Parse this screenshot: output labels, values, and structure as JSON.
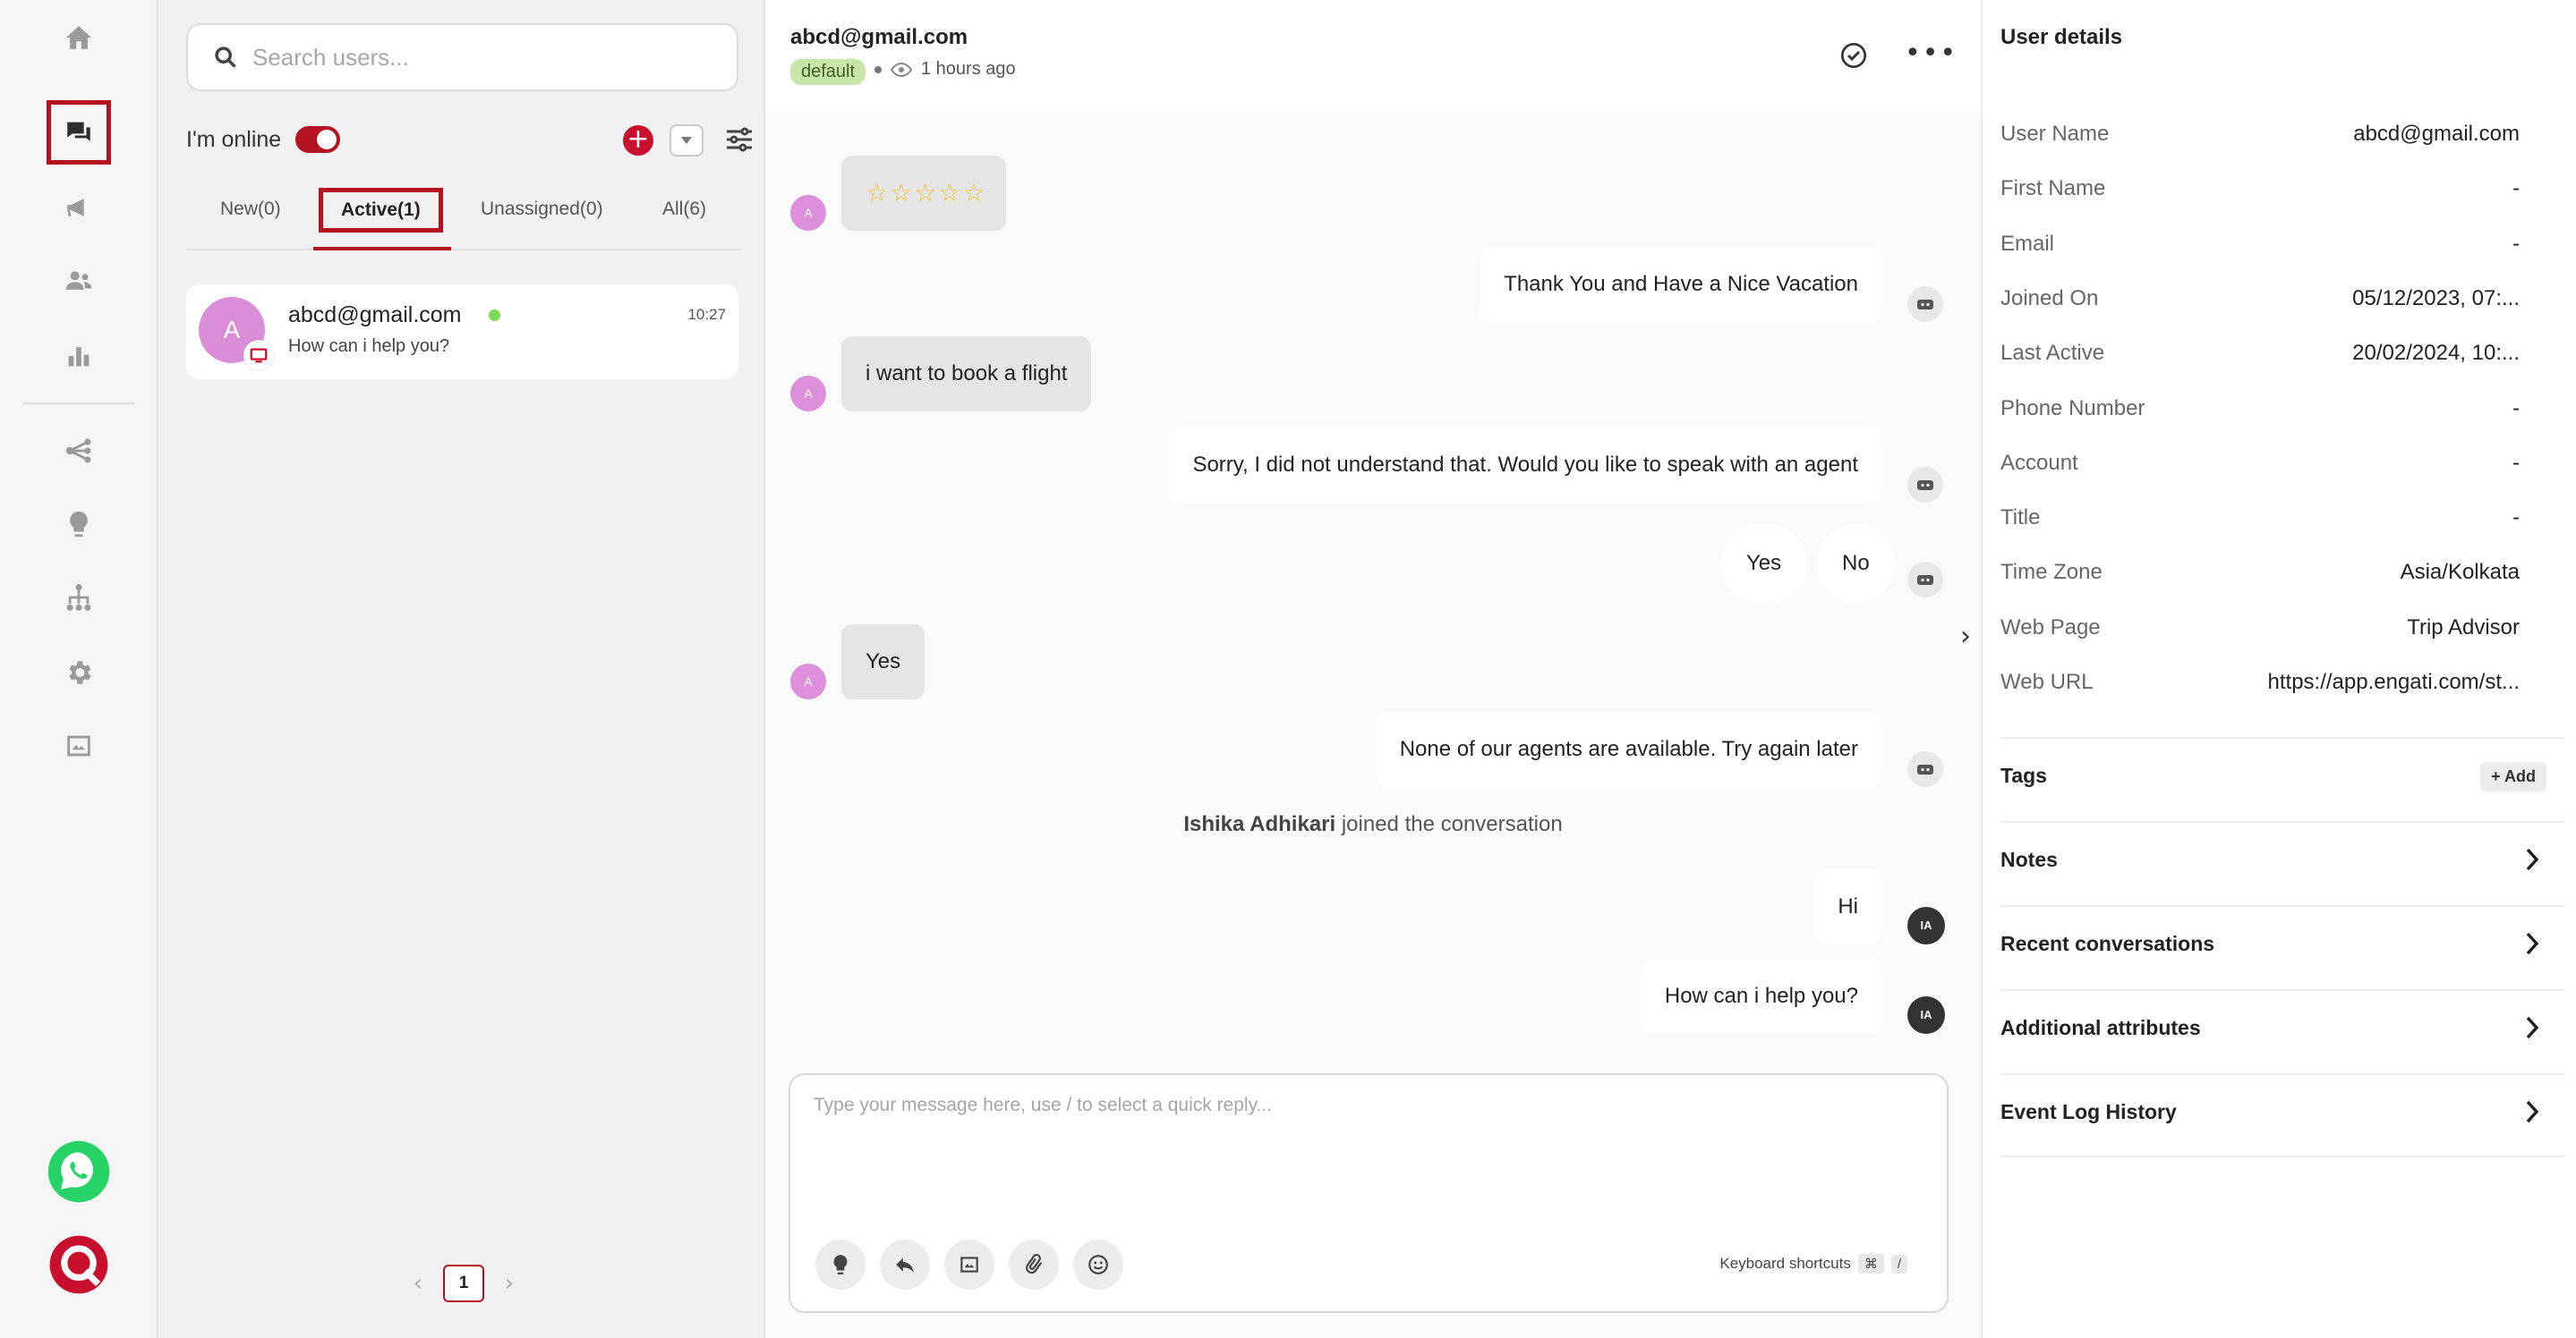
{
  "rail": {
    "items": [
      "home-icon",
      "chat-icon",
      "megaphone-icon",
      "users-icon",
      "analytics-icon",
      "flow-icon",
      "bulb-icon",
      "org-chart-icon",
      "gear-icon",
      "image-swap-icon"
    ],
    "apps": [
      "whatsapp-icon",
      "quickchat-logo"
    ]
  },
  "list": {
    "search_placeholder": "Search users...",
    "online_label": "I'm online",
    "tabs": [
      "New(0)",
      "Active(1)",
      "Unassigned(0)",
      "All(6)"
    ],
    "conversation": {
      "avatar": "A",
      "name": "abcd@gmail.com",
      "preview": "How can i help you?",
      "time": "10:27"
    },
    "pager": {
      "prev": "‹",
      "page": "1",
      "next": "›"
    }
  },
  "chat": {
    "title": "abcd@gmail.com",
    "tag": "default",
    "last_seen": "1 hours ago",
    "messages": {
      "m1": "☆☆☆☆☆",
      "m2": "Thank You and Have a Nice Vacation",
      "m3": "i want to book a flight",
      "m4": "Sorry, I did not understand that. Would you like to speak with an agent",
      "chip_yes": "Yes",
      "chip_no": "No",
      "m5": "Yes",
      "m6": "None of our agents are available. Try again later",
      "sys_name": "Ishika Adhikari",
      "sys_text": " joined the conversation",
      "m7": "Hi",
      "m8": "How can i help you?"
    },
    "user_avatar": "A",
    "agent_avatar": "IA",
    "composer_placeholder": "Type your message here, use / to select a quick reply...",
    "kb_label": "Keyboard shortcuts",
    "kb_key1": "⌘",
    "kb_key2": "/"
  },
  "details": {
    "title": "User details",
    "fields": [
      {
        "k": "User Name",
        "v": "abcd@gmail.com"
      },
      {
        "k": "First Name",
        "v": "-"
      },
      {
        "k": "Email",
        "v": "-"
      },
      {
        "k": "Joined On",
        "v": "05/12/2023, 07:..."
      },
      {
        "k": "Last Active",
        "v": "20/02/2024, 10:..."
      },
      {
        "k": "Phone Number",
        "v": "-"
      },
      {
        "k": "Account",
        "v": "-"
      },
      {
        "k": "Title",
        "v": "-"
      },
      {
        "k": "Time Zone",
        "v": "Asia/Kolkata"
      },
      {
        "k": "Web Page",
        "v": "Trip Advisor"
      },
      {
        "k": "Web URL",
        "v": "https://app.engati.com/st..."
      }
    ],
    "tags_label": "Tags",
    "add_label": "+ Add",
    "sections": [
      "Notes",
      "Recent conversations",
      "Additional attributes",
      "Event Log History"
    ]
  },
  "colors": {
    "brand": "#b3121e",
    "online": "#7ed957",
    "tag_bg": "#c8e6a8",
    "avatar": "#da8ed8"
  }
}
